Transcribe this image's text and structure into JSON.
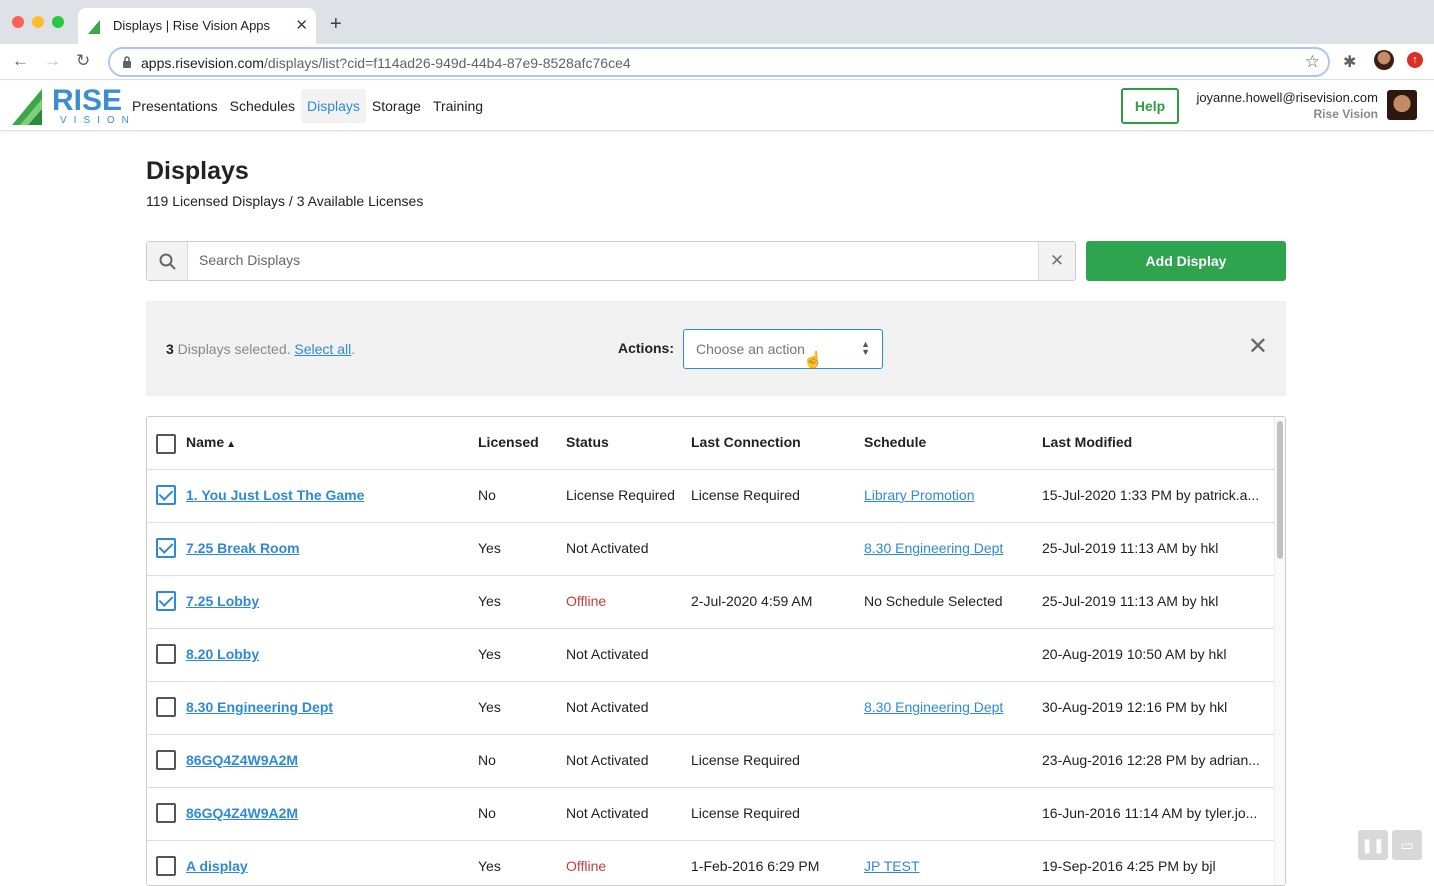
{
  "browser": {
    "tab_title": "Displays | Rise Vision Apps",
    "url_host": "apps.risevision.com",
    "url_path": "/displays/list?cid=f114ad26-949d-44b4-87e9-8528afc76ce4"
  },
  "header": {
    "logo_text": "RISE",
    "logo_subtext": "VISION",
    "nav": [
      "Presentations",
      "Schedules",
      "Displays",
      "Storage",
      "Training"
    ],
    "active_nav": "Displays",
    "help_label": "Help",
    "user_email": "joyanne.howell@risevision.com",
    "user_org": "Rise Vision"
  },
  "main": {
    "title": "Displays",
    "license_info": "119 Licensed Displays / 3 Available Licenses",
    "search_placeholder": "Search Displays",
    "add_label": "Add Display"
  },
  "action_bar": {
    "count": "3",
    "selected_text": " Displays selected. ",
    "select_all": "Select all",
    "period": ".",
    "actions_label": "Actions:",
    "select_placeholder": "Choose an action"
  },
  "table": {
    "headers": {
      "name": "Name",
      "licensed": "Licensed",
      "status": "Status",
      "last_connection": "Last Connection",
      "schedule": "Schedule",
      "last_modified": "Last Modified"
    },
    "rows": [
      {
        "checked": true,
        "name": "1. You Just Lost The Game",
        "licensed": "No",
        "status": "License Required",
        "status_color": "normal",
        "last_connection": "License Required",
        "schedule": "Library Promotion",
        "schedule_link": true,
        "last_modified": "15-Jul-2020 1:33 PM by patrick.a..."
      },
      {
        "checked": true,
        "name": "7.25 Break Room",
        "licensed": "Yes",
        "status": "Not Activated",
        "status_color": "normal",
        "last_connection": "",
        "schedule": "8.30 Engineering Dept",
        "schedule_link": true,
        "last_modified": "25-Jul-2019 11:13 AM by hkl"
      },
      {
        "checked": true,
        "name": "7.25 Lobby",
        "licensed": "Yes",
        "status": "Offline",
        "status_color": "offline",
        "last_connection": "2-Jul-2020 4:59 AM",
        "schedule": "No Schedule Selected",
        "schedule_link": false,
        "last_modified": "25-Jul-2019 11:13 AM by hkl"
      },
      {
        "checked": false,
        "name": "8.20 Lobby",
        "licensed": "Yes",
        "status": "Not Activated",
        "status_color": "normal",
        "last_connection": "",
        "schedule": "",
        "schedule_link": false,
        "last_modified": "20-Aug-2019 10:50 AM by hkl"
      },
      {
        "checked": false,
        "name": "8.30 Engineering Dept",
        "licensed": "Yes",
        "status": "Not Activated",
        "status_color": "normal",
        "last_connection": "",
        "schedule": "8.30 Engineering Dept",
        "schedule_link": true,
        "last_modified": "30-Aug-2019 12:16 PM by hkl"
      },
      {
        "checked": false,
        "name": "86GQ4Z4W9A2M",
        "licensed": "No",
        "status": "Not Activated",
        "status_color": "normal",
        "last_connection": "License Required",
        "schedule": "",
        "schedule_link": false,
        "last_modified": "23-Aug-2016 12:28 PM by adrian..."
      },
      {
        "checked": false,
        "name": "86GQ4Z4W9A2M",
        "licensed": "No",
        "status": "Not Activated",
        "status_color": "normal",
        "last_connection": "License Required",
        "schedule": "",
        "schedule_link": false,
        "last_modified": "16-Jun-2016 11:14 AM by tyler.jo..."
      },
      {
        "checked": false,
        "name": "A display",
        "licensed": "Yes",
        "status": "Offline",
        "status_color": "offline",
        "last_connection": "1-Feb-2016 6:29 PM",
        "schedule": "JP TEST",
        "schedule_link": true,
        "last_modified": "19-Sep-2016 4:25 PM by bjl"
      }
    ]
  },
  "colors": {
    "accent_blue": "#2e8ad8",
    "green": "#2ea44f",
    "offline_red": "#cc3b3b"
  }
}
